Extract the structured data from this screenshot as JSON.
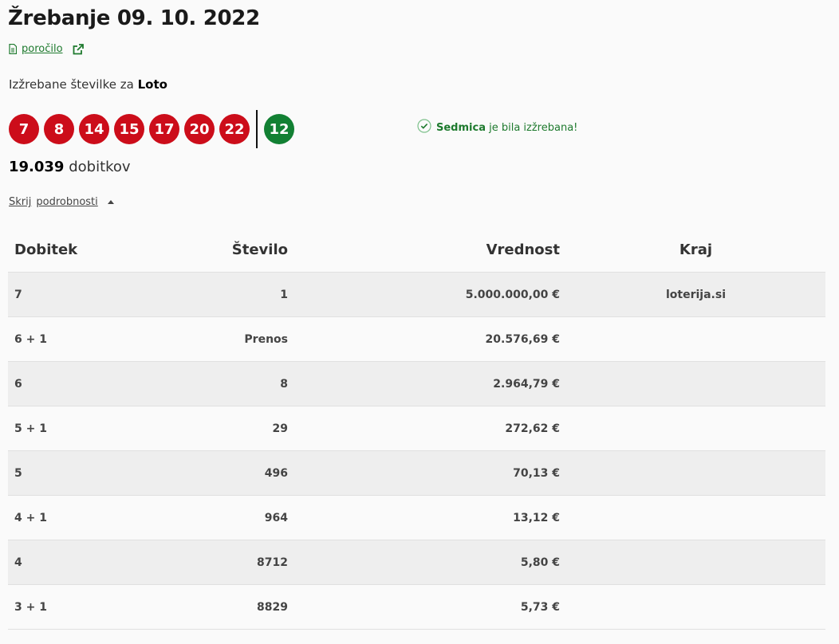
{
  "header": {
    "title": "Žrebanje 09. 10. 2022",
    "report_link": "poročilo"
  },
  "drawn": {
    "label_prefix": "Izžrebane številke za",
    "game": "Loto",
    "numbers": [
      "7",
      "8",
      "14",
      "15",
      "17",
      "20",
      "22"
    ],
    "extra_number": "12"
  },
  "sedmica": {
    "name": "Sedmica",
    "text": "je bila izžrebana!"
  },
  "winners": {
    "count": "19.039",
    "label": "dobitkov"
  },
  "details_toggle": {
    "word1": "Skrij",
    "word2": "podrobnosti"
  },
  "table": {
    "headers": [
      "Dobitek",
      "Število",
      "Vrednost",
      "Kraj"
    ],
    "rows": [
      {
        "dobitek": "7",
        "stevilo": "1",
        "vrednost": "5.000.000,00 €",
        "kraj": "loterija.si"
      },
      {
        "dobitek": "6 + 1",
        "stevilo": "Prenos",
        "vrednost": "20.576,69 €",
        "kraj": ""
      },
      {
        "dobitek": "6",
        "stevilo": "8",
        "vrednost": "2.964,79 €",
        "kraj": ""
      },
      {
        "dobitek": "5 + 1",
        "stevilo": "29",
        "vrednost": "272,62 €",
        "kraj": ""
      },
      {
        "dobitek": "5",
        "stevilo": "496",
        "vrednost": "70,13 €",
        "kraj": ""
      },
      {
        "dobitek": "4 + 1",
        "stevilo": "964",
        "vrednost": "13,12 €",
        "kraj": ""
      },
      {
        "dobitek": "4",
        "stevilo": "8712",
        "vrednost": "5,80 €",
        "kraj": ""
      },
      {
        "dobitek": "3 + 1",
        "stevilo": "8829",
        "vrednost": "5,73 €",
        "kraj": ""
      }
    ]
  },
  "colors": {
    "ball_red": "#cc0d1a",
    "ball_green": "#128033",
    "accent_green": "#1e7a2e"
  },
  "icons": {
    "report": "document-icon",
    "external": "external-link-icon",
    "check": "check-circle-icon",
    "caret": "caret-up-icon"
  }
}
